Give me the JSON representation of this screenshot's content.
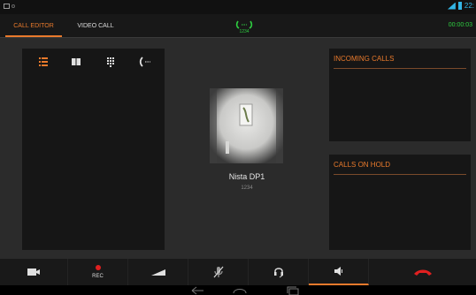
{
  "tabs": [
    {
      "label": "CALL EDITOR",
      "active": true
    },
    {
      "label": "VIDEO CALL",
      "active": false
    }
  ],
  "active_call": {
    "number": "1234",
    "icon": "phone-ringing-icon"
  },
  "timer": "00:00:03",
  "status_bar": {
    "time": "22:"
  },
  "left_panel": {
    "icons": [
      "list-icon",
      "contacts-book-icon",
      "dialpad-icon",
      "call-transfer-icon"
    ]
  },
  "caller": {
    "name": "Nista DP1",
    "number": "1234"
  },
  "panels": {
    "incoming_title": "INCOMING CALLS",
    "hold_title": "CALLS ON HOLD"
  },
  "bottom_bar": {
    "rec_label": "REC"
  },
  "colors": {
    "accent": "#e97a2c",
    "active_green": "#2ecc40",
    "hangup_red": "#e02020"
  }
}
